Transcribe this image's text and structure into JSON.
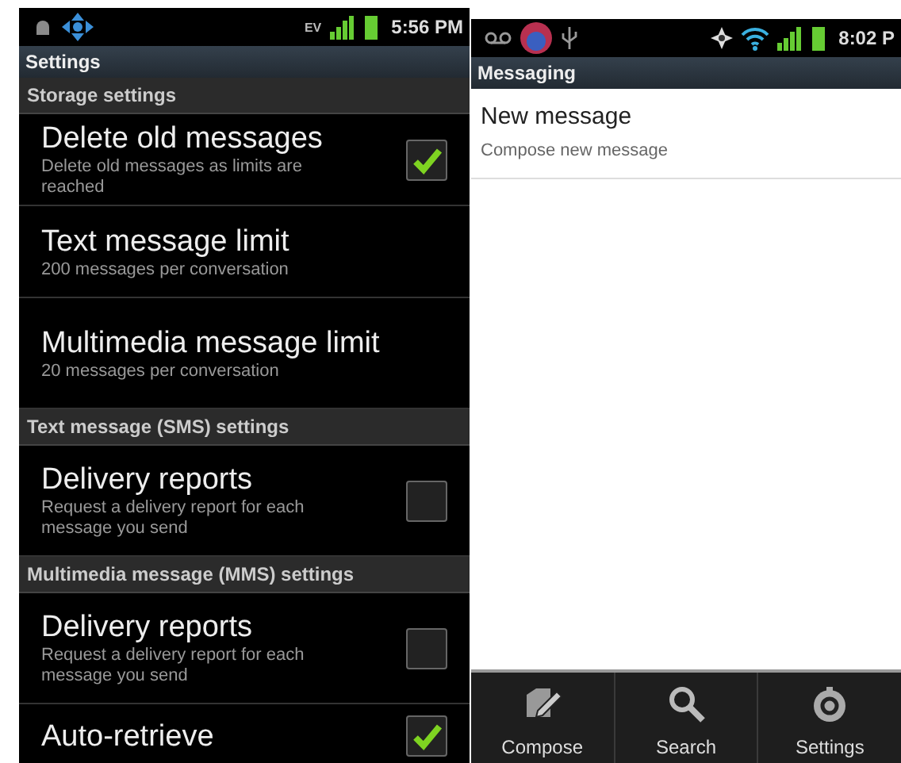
{
  "settings_screen": {
    "status_bar": {
      "network": "EV",
      "time": "5:56 PM"
    },
    "title": "Settings",
    "items": [
      {
        "kind": "header",
        "title": "Storage settings"
      },
      {
        "kind": "check",
        "title": "Delete old messages",
        "summary": "Delete old messages as limits are reached",
        "checked": true
      },
      {
        "kind": "text",
        "title": "Text message limit",
        "summary": "200 messages per conversation"
      },
      {
        "kind": "text",
        "title": "Multimedia message limit",
        "summary": "20 messages per conversation"
      },
      {
        "kind": "header",
        "title": "Text message (SMS) settings"
      },
      {
        "kind": "check",
        "title": "Delivery reports",
        "summary": "Request a delivery report for each message you send",
        "checked": false
      },
      {
        "kind": "header",
        "title": "Multimedia message (MMS) settings"
      },
      {
        "kind": "check",
        "title": "Delivery reports",
        "summary": "Request a delivery report for each message you send",
        "checked": false
      },
      {
        "kind": "check",
        "title": "Auto-retrieve",
        "checked": true
      }
    ]
  },
  "messaging_screen": {
    "status_bar": {
      "time": "8:02 P"
    },
    "title": "Messaging",
    "items": [
      {
        "title": "New message",
        "summary": "Compose new message"
      }
    ],
    "menu": [
      {
        "kind": "compose",
        "label": "Compose"
      },
      {
        "kind": "search",
        "label": "Search"
      },
      {
        "kind": "settings",
        "label": "Settings"
      }
    ]
  }
}
